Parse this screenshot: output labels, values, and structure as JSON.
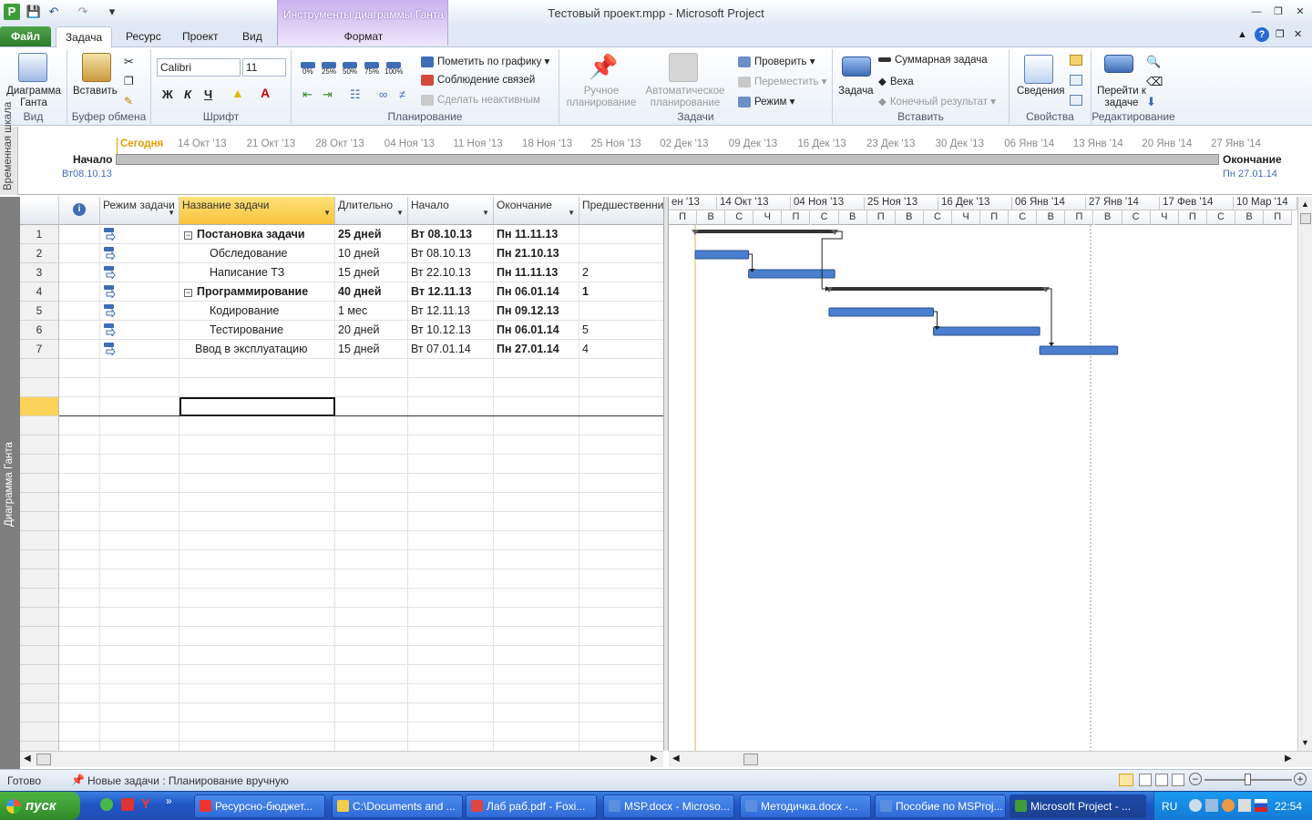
{
  "window": {
    "title": "Тестовый проект.mpp  -  Microsoft Project",
    "context_tab_group": "Инструменты диаграммы Ганта",
    "context_tab": "Формат"
  },
  "tabs": [
    "Файл",
    "Задача",
    "Ресурс",
    "Проект",
    "Вид"
  ],
  "ribbon": {
    "view": {
      "button": "Диаграмма Ганта",
      "label": "Вид"
    },
    "clipboard": {
      "paste": "Вставить",
      "label": "Буфер обмена"
    },
    "font": {
      "family": "Calibri",
      "size": "11",
      "bold": "Ж",
      "italic": "К",
      "underline": "Ч",
      "label": "Шрифт"
    },
    "schedule": {
      "percents": [
        "0%",
        "25%",
        "50%",
        "75%",
        "100%"
      ],
      "mark_on_track": "Пометить по графику",
      "respect_links": "Соблюдение связей",
      "inactivate": "Сделать неактивным",
      "label": "Планирование"
    },
    "tasks": {
      "manual": "Ручное планирование",
      "auto": "Автоматическое планирование",
      "inspect": "Проверить",
      "move": "Переместить",
      "mode": "Режим",
      "label": "Задачи"
    },
    "insert": {
      "task": "Задача",
      "summary": "Суммарная задача",
      "milestone": "Веха",
      "deliverable": "Конечный результат",
      "label": "Вставить"
    },
    "properties": {
      "info": "Сведения",
      "label": "Свойства"
    },
    "editing": {
      "goto": "Перейти к задаче",
      "label": "Редактирование"
    }
  },
  "timeline": {
    "side_label": "Временная шкала",
    "today": "Сегодня",
    "dates": [
      "14 Окт '13",
      "21 Окт '13",
      "28 Окт '13",
      "04 Ноя '13",
      "11 Ноя '13",
      "18 Ноя '13",
      "25 Ноя '13",
      "02 Дек '13",
      "09 Дек '13",
      "16 Дек '13",
      "23 Дек '13",
      "30 Дек '13",
      "06 Янв '14",
      "13 Янв '14",
      "20 Янв '14",
      "27 Янв '14"
    ],
    "start_label": "Начало",
    "start_date": "Вт08.10.13",
    "finish_label": "Окончание",
    "finish_date": "Пн 27.01.14"
  },
  "gantt_side_label": "Диаграмма Ганта",
  "columns": {
    "mode": "Режим задачи",
    "name": "Название задачи",
    "duration": "Длительно",
    "start": "Начало",
    "finish": "Окончание",
    "pred": "Предшественни"
  },
  "tasks": [
    {
      "id": "1",
      "name": "Постановка задачи",
      "duration": "25 дней",
      "start": "Вт 08.10.13",
      "finish": "Пн 11.11.13",
      "pred": "",
      "summary": true
    },
    {
      "id": "2",
      "name": "Обследование",
      "duration": "10 дней",
      "start": "Вт 08.10.13",
      "finish": "Пн 21.10.13",
      "pred": "",
      "summary": false
    },
    {
      "id": "3",
      "name": "Написание ТЗ",
      "duration": "15 дней",
      "start": "Вт 22.10.13",
      "finish": "Пн 11.11.13",
      "pred": "2",
      "summary": false
    },
    {
      "id": "4",
      "name": "Программирование",
      "duration": "40 дней",
      "start": "Вт 12.11.13",
      "finish": "Пн 06.01.14",
      "pred": "1",
      "summary": true
    },
    {
      "id": "5",
      "name": "Кодирование",
      "duration": "1 мес",
      "start": "Вт 12.11.13",
      "finish": "Пн 09.12.13",
      "pred": "",
      "summary": false
    },
    {
      "id": "6",
      "name": "Тестирование",
      "duration": "20 дней",
      "start": "Вт 10.12.13",
      "finish": "Пн 06.01.14",
      "pred": "5",
      "summary": false
    },
    {
      "id": "7",
      "name": "Ввод в эксплуатацию",
      "duration": "15 дней",
      "start": "Вт 07.01.14",
      "finish": "Пн 27.01.14",
      "pred": "4",
      "summary": false
    }
  ],
  "chart": {
    "top_scale": [
      "ен '13",
      "14 Окт '13",
      "04 Ноя '13",
      "25 Ноя '13",
      "16 Дек '13",
      "06 Янв '14",
      "27 Янв '14",
      "17 Фев '14",
      "10 Мар '14"
    ],
    "bottom_scale": [
      "П",
      "В",
      "С",
      "Ч",
      "П",
      "С",
      "В",
      "П",
      "В",
      "С",
      "Ч",
      "П",
      "С",
      "В",
      "П",
      "В",
      "С",
      "Ч",
      "П",
      "С",
      "В",
      "П"
    ],
    "bars": [
      {
        "row": 1,
        "from": 0.0,
        "to": 0.222,
        "type": "summary"
      },
      {
        "row": 2,
        "from": 0.0,
        "to": 0.085,
        "type": "task"
      },
      {
        "row": 3,
        "from": 0.085,
        "to": 0.222,
        "type": "task"
      },
      {
        "row": 4,
        "from": 0.213,
        "to": 0.558,
        "type": "summary"
      },
      {
        "row": 5,
        "from": 0.213,
        "to": 0.379,
        "type": "task"
      },
      {
        "row": 6,
        "from": 0.379,
        "to": 0.548,
        "type": "task"
      },
      {
        "row": 7,
        "from": 0.548,
        "to": 0.672,
        "type": "task"
      }
    ]
  },
  "status": {
    "ready": "Готово",
    "new_tasks": "Новые задачи : Планирование вручную"
  },
  "taskbar": {
    "start": "пуск",
    "buttons": [
      "Ресурсно-бюджет...",
      "C:\\Documents and ...",
      "Лаб раб.pdf - Foxi...",
      "MSP.docx - Microso...",
      "Методичка.docx -...",
      "Пособие по MSProj...",
      "Microsoft Project - ..."
    ],
    "lang": "RU",
    "clock": "22:54"
  },
  "colors": {
    "bar": "#4a7fcf",
    "summary": "#333333",
    "selected_header": "#f8c33b",
    "file_tab": "#2c7a28"
  }
}
